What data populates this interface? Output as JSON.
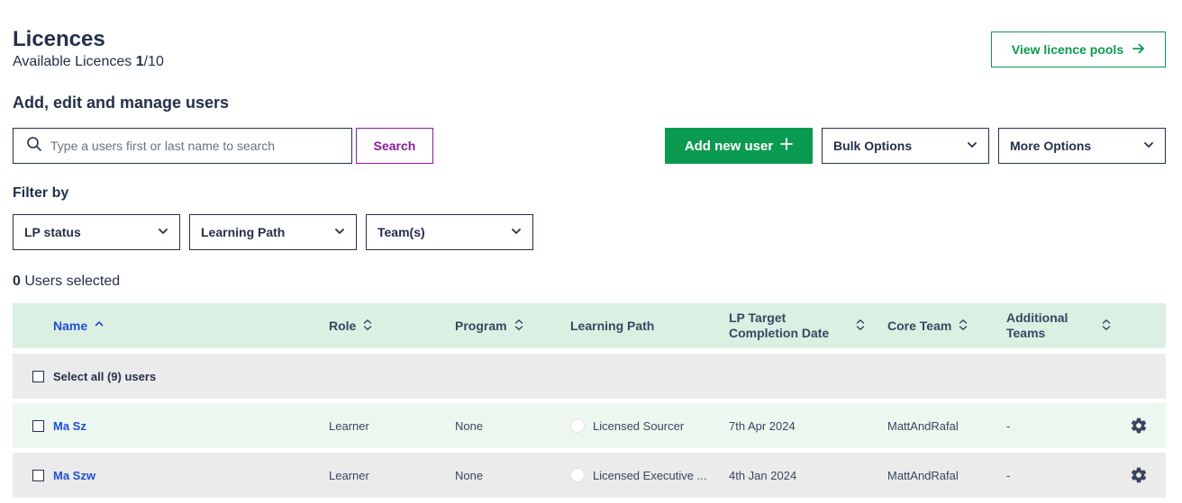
{
  "header": {
    "title": "Licences",
    "available_label": "Available Licences",
    "available_used": "1",
    "available_total": "/10",
    "view_pools_label": "View licence pools"
  },
  "subtitle": "Add, edit and manage users",
  "search": {
    "placeholder": "Type a users first or last name to search",
    "button_label": "Search"
  },
  "actions": {
    "add_user_label": "Add new user",
    "bulk_options_label": "Bulk Options",
    "more_options_label": "More Options"
  },
  "filters": {
    "label": "Filter by",
    "items": [
      {
        "label": "LP status"
      },
      {
        "label": "Learning Path"
      },
      {
        "label": "Team(s)"
      }
    ]
  },
  "selection": {
    "count": "0",
    "label": " Users selected",
    "select_all_label": "Select all (9) users"
  },
  "table": {
    "columns": [
      {
        "label": "Name",
        "sort": "asc"
      },
      {
        "label": "Role",
        "sort": "both"
      },
      {
        "label": "Program",
        "sort": "both"
      },
      {
        "label": "Learning Path",
        "sort": "none"
      },
      {
        "label": "LP Target Completion Date",
        "line1": "LP Target",
        "line2": "Completion Date",
        "sort": "both"
      },
      {
        "label": "Core Team",
        "sort": "both"
      },
      {
        "label": "Additional Teams",
        "line1": "Additional",
        "line2": "Teams",
        "sort": "both"
      }
    ],
    "rows": [
      {
        "name": "Ma Sz",
        "role": "Learner",
        "program": "None",
        "learning_path": "Licensed Sourcer",
        "target_date": "7th Apr 2024",
        "core_team": "MattAndRafal",
        "additional_teams": "-"
      },
      {
        "name": "Ma Szw",
        "role": "Learner",
        "program": "None",
        "learning_path": "Licensed Executive ...",
        "target_date": "4th Jan 2024",
        "core_team": "MattAndRafal",
        "additional_teams": "-"
      }
    ]
  },
  "colors": {
    "accent_green": "#0a9a50",
    "search_purple": "#8a1a9b",
    "link_blue": "#1f4fd6",
    "header_row_bg": "#dcefe3",
    "row_alt_bg": "#ebebeb",
    "row_first_bg": "#ecf7f0"
  },
  "icons": {
    "search": "search-icon",
    "arrow": "arrow-right-icon",
    "plus": "plus-icon",
    "chevron": "chevron-down-icon",
    "sort": "sort-icon",
    "settings": "gear-icon"
  }
}
